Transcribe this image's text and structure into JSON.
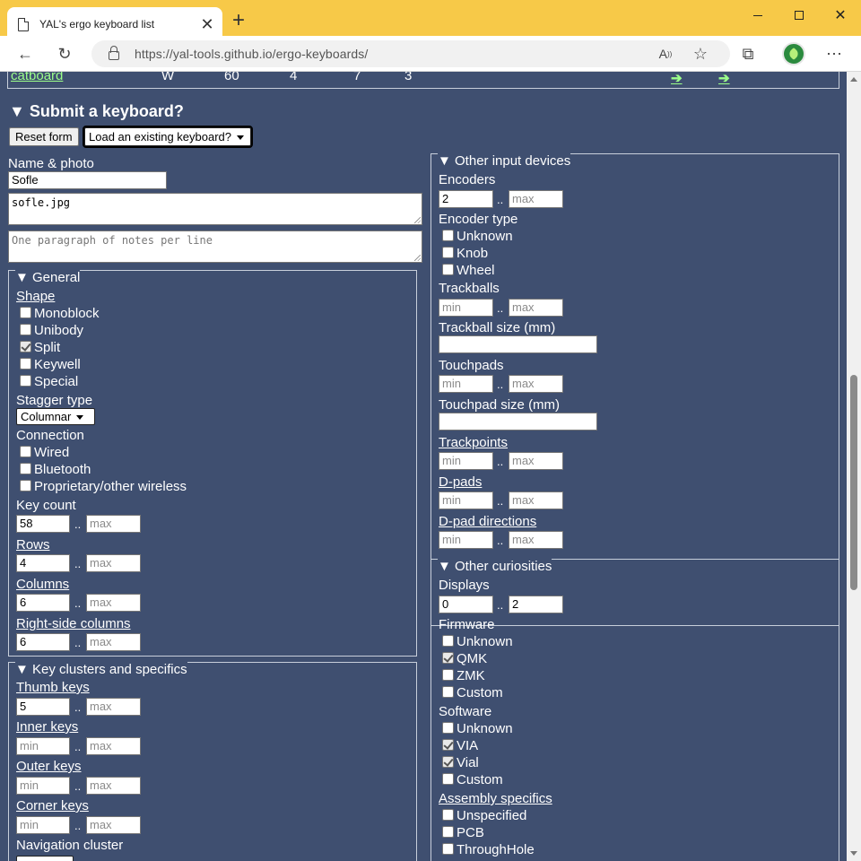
{
  "browser": {
    "tab_title": "YAL's ergo keyboard list",
    "url": "https://yal-tools.github.io/ergo-keyboards/"
  },
  "table_row": {
    "name": "catboard",
    "cells": [
      "W",
      "60",
      "4",
      "7",
      "3"
    ],
    "arrows": [
      "➔",
      "➔"
    ]
  },
  "submit": {
    "heading": "▼ Submit a keyboard?",
    "reset_label": "Reset form",
    "load_select": "Load an existing keyboard?",
    "name_photo_label": "Name & photo",
    "name_value": "Sofle",
    "photo_value": "sofle.jpg",
    "notes_placeholder": "One paragraph of notes per line"
  },
  "placeholders": {
    "min": "min",
    "max": "max",
    "sep": ".."
  },
  "general": {
    "legend": "▼ General",
    "shape_label": "Shape",
    "shape_options": [
      {
        "label": "Monoblock",
        "checked": false
      },
      {
        "label": "Unibody",
        "checked": false
      },
      {
        "label": "Split",
        "checked": true
      },
      {
        "label": "Keywell",
        "checked": false
      },
      {
        "label": "Special",
        "checked": false
      }
    ],
    "stagger_label": "Stagger type",
    "stagger_value": "Columnar",
    "connection_label": "Connection",
    "connection_options": [
      {
        "label": "Wired",
        "checked": false
      },
      {
        "label": "Bluetooth",
        "checked": false
      },
      {
        "label": "Proprietary/other wireless",
        "checked": false
      }
    ],
    "key_count_label": "Key count",
    "key_count_min": "58",
    "rows_label": "Rows",
    "rows_min": "4",
    "columns_label": "Columns",
    "columns_min": "6",
    "right_columns_label": "Right-side columns",
    "right_columns_min": "6"
  },
  "key_clusters": {
    "legend": "▼ Key clusters and specifics",
    "thumb_label": "Thumb keys",
    "thumb_min": "5",
    "inner_label": "Inner keys",
    "outer_label": "Outer keys",
    "corner_label": "Corner keys",
    "nav_label": "Navigation cluster"
  },
  "other_input": {
    "legend": "▼ Other input devices",
    "encoders_label": "Encoders",
    "encoders_min": "2",
    "encoder_type_label": "Encoder type",
    "encoder_types": [
      {
        "label": "Unknown",
        "checked": false
      },
      {
        "label": "Knob",
        "checked": false
      },
      {
        "label": "Wheel",
        "checked": false
      }
    ],
    "trackballs_label": "Trackballs",
    "trackball_size_label": "Trackball size (mm)",
    "touchpads_label": "Touchpads",
    "touchpad_size_label": "Touchpad size (mm)",
    "trackpoints_label": "Trackpoints",
    "dpads_label": "D-pads",
    "dpad_dirs_label": "D-pad directions"
  },
  "curiosities": {
    "legend": "▼ Other curiosities",
    "displays_label": "Displays",
    "displays_min": "0",
    "displays_max": "2",
    "firmware_label": "Firmware",
    "firmware_options": [
      {
        "label": "Unknown",
        "checked": false
      },
      {
        "label": "QMK",
        "checked": true
      },
      {
        "label": "ZMK",
        "checked": false
      },
      {
        "label": "Custom",
        "checked": false
      }
    ],
    "software_label": "Software",
    "software_options": [
      {
        "label": "Unknown",
        "checked": false
      },
      {
        "label": "VIA",
        "checked": true
      },
      {
        "label": "Vial",
        "checked": true
      },
      {
        "label": "Custom",
        "checked": false
      }
    ],
    "assembly_label": "Assembly specifics",
    "assembly_options": [
      {
        "label": "Unspecified",
        "checked": false
      },
      {
        "label": "PCB",
        "checked": false
      },
      {
        "label": "ThroughHole",
        "checked": false
      }
    ]
  }
}
